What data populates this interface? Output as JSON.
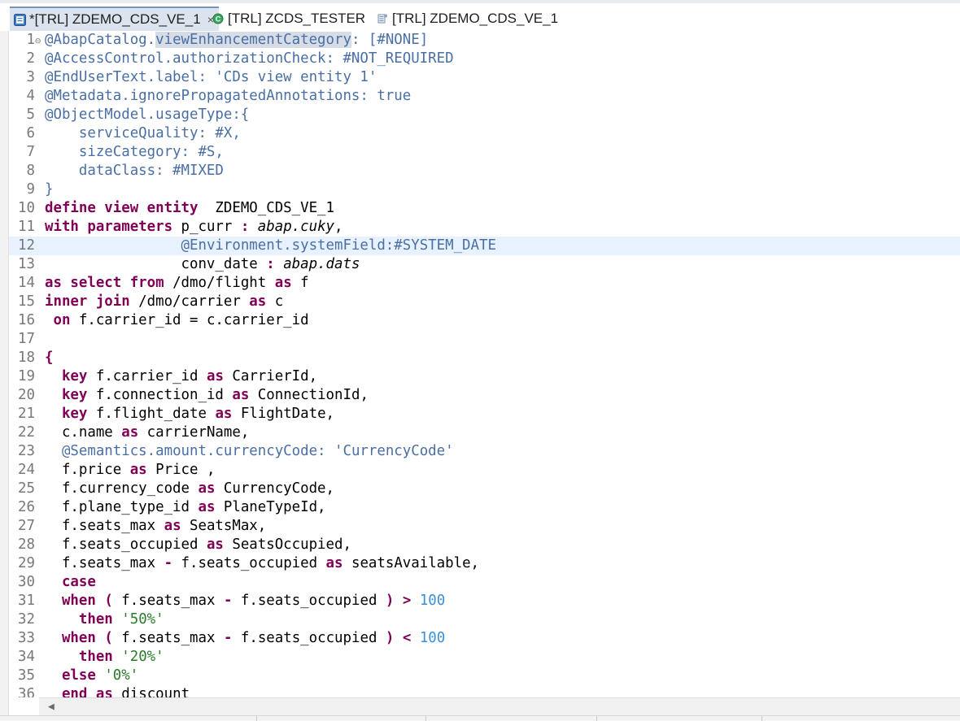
{
  "tabs": [
    {
      "label": "*[TRL] ZDEMO_CDS_VE_1",
      "active": true,
      "icon": "cds-ddl-icon",
      "closable": true
    },
    {
      "label": "[TRL] ZCDS_TESTER",
      "active": false,
      "icon": "class-icon"
    },
    {
      "label": "[TRL] ZDEMO_CDS_VE_1",
      "active": false,
      "icon": "data-preview-icon"
    }
  ],
  "close_glyph": "×",
  "editor": {
    "current_line": 12,
    "lines": [
      {
        "n": "1",
        "fold": "⊖",
        "tokens": [
          [
            "ann",
            "@AbapCatalog."
          ],
          [
            "ann hl",
            "viewEnhancementCategory"
          ],
          [
            "ann",
            ": [#NONE]"
          ]
        ]
      },
      {
        "n": "2",
        "tokens": [
          [
            "ann",
            "@AccessControl.authorizationCheck: #NOT_REQUIRED"
          ]
        ]
      },
      {
        "n": "3",
        "tokens": [
          [
            "ann",
            "@EndUserText.label: "
          ],
          [
            "ann",
            "'CDs view entity 1'"
          ]
        ]
      },
      {
        "n": "4",
        "tokens": [
          [
            "ann",
            "@Metadata.ignorePropagatedAnnotations: true"
          ]
        ]
      },
      {
        "n": "5",
        "tokens": [
          [
            "ann",
            "@ObjectModel.usageType:{"
          ]
        ]
      },
      {
        "n": "6",
        "tokens": [
          [
            "ann",
            "    serviceQuality: #X,"
          ]
        ]
      },
      {
        "n": "7",
        "tokens": [
          [
            "ann",
            "    sizeCategory: #S,"
          ]
        ]
      },
      {
        "n": "8",
        "tokens": [
          [
            "ann",
            "    dataClass: #MIXED"
          ]
        ]
      },
      {
        "n": "9",
        "tokens": [
          [
            "ann",
            "}"
          ]
        ]
      },
      {
        "n": "10",
        "tokens": [
          [
            "kw",
            "define view entity"
          ],
          [
            "",
            "  ZDEMO_CDS_VE_1"
          ]
        ]
      },
      {
        "n": "11",
        "tokens": [
          [
            "kw",
            "with parameters"
          ],
          [
            "",
            " p_curr "
          ],
          [
            "kw",
            ":"
          ],
          [
            "",
            " "
          ],
          [
            "it",
            "abap.cuky"
          ],
          [
            "",
            ","
          ]
        ]
      },
      {
        "n": "12",
        "tokens": [
          [
            "",
            "                "
          ],
          [
            "ann",
            "@Environment.systemField:#SYSTEM_DATE"
          ]
        ]
      },
      {
        "n": "13",
        "tokens": [
          [
            "",
            "                conv_date "
          ],
          [
            "kw",
            ":"
          ],
          [
            "",
            " "
          ],
          [
            "it",
            "abap.dats"
          ]
        ]
      },
      {
        "n": "14",
        "tokens": [
          [
            "kw",
            "as select from"
          ],
          [
            "",
            " /dmo/flight "
          ],
          [
            "kw",
            "as"
          ],
          [
            "",
            " f"
          ]
        ]
      },
      {
        "n": "15",
        "tokens": [
          [
            "kw",
            "inner join"
          ],
          [
            "",
            " /dmo/carrier "
          ],
          [
            "kw",
            "as"
          ],
          [
            "",
            " c"
          ]
        ]
      },
      {
        "n": "16",
        "tokens": [
          [
            "",
            ""
          ],
          [
            "kw",
            " on"
          ],
          [
            "",
            " f.carrier_id = c.carrier_id"
          ]
        ]
      },
      {
        "n": "17",
        "tokens": []
      },
      {
        "n": "18",
        "tokens": [
          [
            "kw",
            "{"
          ]
        ]
      },
      {
        "n": "19",
        "tokens": [
          [
            "",
            "  "
          ],
          [
            "kw",
            "key"
          ],
          [
            "",
            " f.carrier_id "
          ],
          [
            "kw",
            "as"
          ],
          [
            "",
            " CarrierId,"
          ]
        ]
      },
      {
        "n": "20",
        "tokens": [
          [
            "",
            "  "
          ],
          [
            "kw",
            "key"
          ],
          [
            "",
            " f.connection_id "
          ],
          [
            "kw",
            "as"
          ],
          [
            "",
            " ConnectionId,"
          ]
        ]
      },
      {
        "n": "21",
        "tokens": [
          [
            "",
            "  "
          ],
          [
            "kw",
            "key"
          ],
          [
            "",
            " f.flight_date "
          ],
          [
            "kw",
            "as"
          ],
          [
            "",
            " FlightDate,"
          ]
        ]
      },
      {
        "n": "22",
        "tokens": [
          [
            "",
            "  c.name "
          ],
          [
            "kw",
            "as"
          ],
          [
            "",
            " carrierName,"
          ]
        ]
      },
      {
        "n": "23",
        "tokens": [
          [
            "",
            "  "
          ],
          [
            "ann",
            "@Semantics.amount.currencyCode: "
          ],
          [
            "ann",
            "'CurrencyCode'"
          ]
        ]
      },
      {
        "n": "24",
        "tokens": [
          [
            "",
            "  f.price "
          ],
          [
            "kw",
            "as"
          ],
          [
            "",
            " Price ,"
          ]
        ]
      },
      {
        "n": "25",
        "tokens": [
          [
            "",
            "  f.currency_code "
          ],
          [
            "kw",
            "as"
          ],
          [
            "",
            " CurrencyCode,"
          ]
        ]
      },
      {
        "n": "26",
        "tokens": [
          [
            "",
            "  f.plane_type_id "
          ],
          [
            "kw",
            "as"
          ],
          [
            "",
            " PlaneTypeId,"
          ]
        ]
      },
      {
        "n": "27",
        "tokens": [
          [
            "",
            "  f.seats_max "
          ],
          [
            "kw",
            "as"
          ],
          [
            "",
            " SeatsMax,"
          ]
        ]
      },
      {
        "n": "28",
        "tokens": [
          [
            "",
            "  f.seats_occupied "
          ],
          [
            "kw",
            "as"
          ],
          [
            "",
            " SeatsOccupied,"
          ]
        ]
      },
      {
        "n": "29",
        "tokens": [
          [
            "",
            "  f.seats_max "
          ],
          [
            "kw",
            "-"
          ],
          [
            "",
            " f.seats_occupied "
          ],
          [
            "kw",
            "as"
          ],
          [
            "",
            " seatsAvailable,"
          ]
        ]
      },
      {
        "n": "30",
        "tokens": [
          [
            "",
            "  "
          ],
          [
            "kw",
            "case"
          ]
        ]
      },
      {
        "n": "31",
        "tokens": [
          [
            "",
            "  "
          ],
          [
            "kw",
            "when"
          ],
          [
            "",
            " "
          ],
          [
            "kw",
            "("
          ],
          [
            "",
            " f.seats_max "
          ],
          [
            "kw",
            "-"
          ],
          [
            "",
            " f.seats_occupied "
          ],
          [
            "kw",
            ")"
          ],
          [
            "",
            " "
          ],
          [
            "kw",
            ">"
          ],
          [
            "",
            " "
          ],
          [
            "num",
            "100"
          ]
        ]
      },
      {
        "n": "32",
        "tokens": [
          [
            "",
            "    "
          ],
          [
            "kw",
            "then"
          ],
          [
            "",
            " "
          ],
          [
            "str",
            "'50%'"
          ]
        ]
      },
      {
        "n": "33",
        "tokens": [
          [
            "",
            "  "
          ],
          [
            "kw",
            "when"
          ],
          [
            "",
            " "
          ],
          [
            "kw",
            "("
          ],
          [
            "",
            " f.seats_max "
          ],
          [
            "kw",
            "-"
          ],
          [
            "",
            " f.seats_occupied "
          ],
          [
            "kw",
            ")"
          ],
          [
            "",
            " "
          ],
          [
            "kw",
            "<"
          ],
          [
            "",
            " "
          ],
          [
            "num",
            "100"
          ]
        ]
      },
      {
        "n": "34",
        "tokens": [
          [
            "",
            "    "
          ],
          [
            "kw",
            "then"
          ],
          [
            "",
            " "
          ],
          [
            "str",
            "'20%'"
          ]
        ]
      },
      {
        "n": "35",
        "tokens": [
          [
            "",
            "  "
          ],
          [
            "kw",
            "else"
          ],
          [
            "",
            " "
          ],
          [
            "str",
            "'0%'"
          ]
        ]
      },
      {
        "n": "36",
        "tokens": [
          [
            "",
            "  "
          ],
          [
            "kw",
            "end"
          ],
          [
            "",
            " "
          ],
          [
            "kw",
            "as"
          ],
          [
            "",
            " discount"
          ]
        ]
      }
    ]
  },
  "scroll_left_glyph": "◀"
}
